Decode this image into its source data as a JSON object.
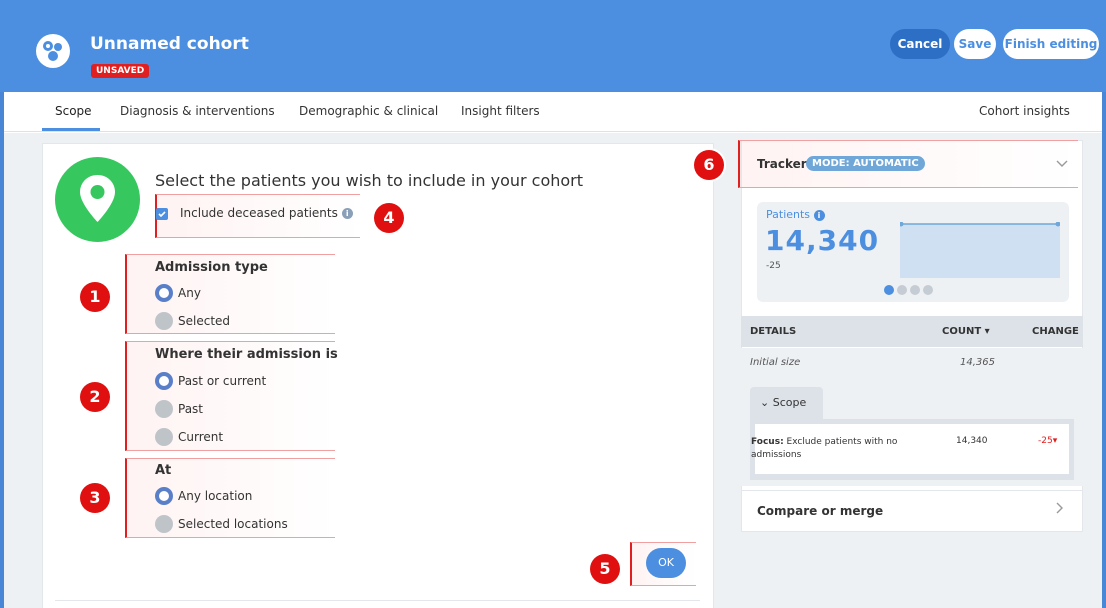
{
  "header": {
    "title": "Unnamed cohort",
    "unsaved_badge": "UNSAVED",
    "cancel": "Cancel",
    "save": "Save",
    "finish": "Finish editing"
  },
  "tabs": [
    {
      "label": "Scope"
    },
    {
      "label": "Diagnosis & interventions"
    },
    {
      "label": "Demographic & clinical"
    },
    {
      "label": "Insight filters"
    },
    {
      "label": "Cohort insights"
    }
  ],
  "scope": {
    "heading": "Select the patients you wish to include in your cohort",
    "include_deceased": "Include deceased patients",
    "admission_type": {
      "title": "Admission type",
      "options": [
        "Any",
        "Selected"
      ],
      "selected": "Any"
    },
    "admission_where": {
      "title": "Where their admission is",
      "options": [
        "Past or current",
        "Past",
        "Current"
      ],
      "selected": "Past or current"
    },
    "at": {
      "title": "At",
      "options": [
        "Any location",
        "Selected locations"
      ],
      "selected": "Any location"
    },
    "ok": "OK"
  },
  "callouts": [
    "1",
    "2",
    "3",
    "4",
    "5",
    "6"
  ],
  "tracker": {
    "label": "Tracker",
    "mode": "MODE: AUTOMATIC",
    "patients_label": "Patients",
    "patients_value": "14,340",
    "delta": "-25",
    "details_header": "DETAILS",
    "count_header": "COUNT",
    "change_header": "CHANGE",
    "initial_label": "Initial size",
    "initial_value": "14,365",
    "scope_tab": "Scope",
    "focus_label": "Focus:",
    "focus_text": "Exclude patients with no admissions",
    "focus_value": "14,340",
    "focus_change": "-25",
    "compare": "Compare or merge"
  },
  "colors": {
    "brand": "#4c8fe0",
    "alert": "#e02020",
    "pin": "#36c85e"
  }
}
